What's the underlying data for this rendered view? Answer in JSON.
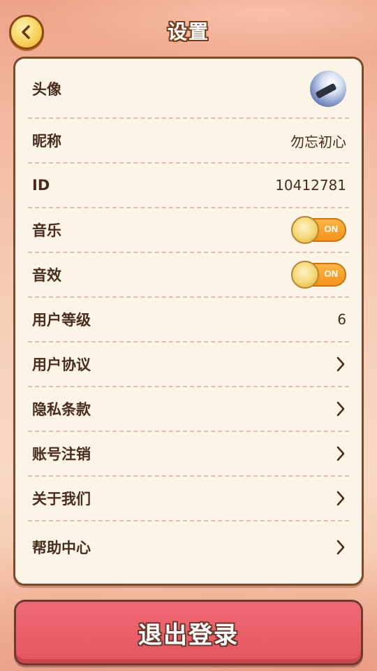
{
  "header": {
    "title": "设置",
    "back_icon": "chevron-left-icon"
  },
  "settings": {
    "avatar": {
      "label": "头像",
      "icon": "avatar-image"
    },
    "nickname": {
      "label": "昵称",
      "value": "勿忘初心"
    },
    "id": {
      "label": "ID",
      "value": "10412781"
    },
    "music": {
      "label": "音乐",
      "toggle_text": "ON",
      "on": true
    },
    "sound": {
      "label": "音效",
      "toggle_text": "ON",
      "on": true
    },
    "level": {
      "label": "用户等级",
      "value": "6"
    },
    "agreement": {
      "label": "用户协议",
      "icon": "chevron-right-icon"
    },
    "privacy": {
      "label": "隐私条款",
      "icon": "chevron-right-icon"
    },
    "delete_account": {
      "label": "账号注销",
      "icon": "chevron-right-icon"
    },
    "about": {
      "label": "关于我们",
      "icon": "chevron-right-icon"
    },
    "help": {
      "label": "帮助中心",
      "icon": "chevron-right-icon"
    }
  },
  "logout": {
    "label": "退出登录"
  },
  "colors": {
    "card_bg": "#fcf5e7",
    "card_border": "#7b4a2c",
    "toggle_on": "#f3921a",
    "logout_bg": "#e45560",
    "text": "#4a2c1e"
  }
}
